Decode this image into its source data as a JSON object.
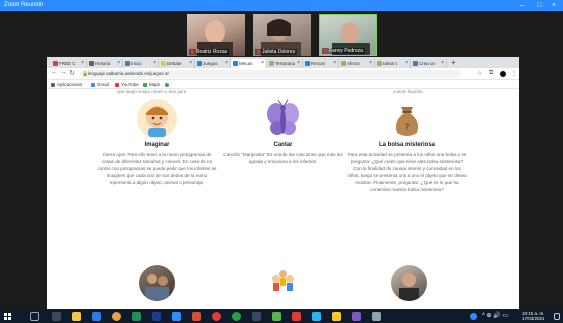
{
  "zoom": {
    "title": "Zoom Reunión",
    "window_controls": [
      "–",
      "□",
      "×"
    ],
    "participants": [
      {
        "name": "Beatriz Rozas"
      },
      {
        "name": "Julieta Dolores"
      },
      {
        "name": "Fanny Pedroza"
      }
    ]
  },
  "browser": {
    "tabs": [
      {
        "label": "FREE C",
        "color": "#e53935"
      },
      {
        "label": "Historia",
        "color": "#616161"
      },
      {
        "label": "Inicio",
        "color": "#1e88e5"
      },
      {
        "label": "Debate",
        "color": "#fbc02d"
      },
      {
        "label": "Juegos",
        "color": "#1e88e5"
      },
      {
        "label": "Mecan",
        "color": "#1e88e5"
      },
      {
        "label": "Temprana",
        "color": "#8bc34a"
      },
      {
        "label": "Recurs",
        "color": "#1e88e5"
      },
      {
        "label": "Afecto",
        "color": "#8bc34a"
      },
      {
        "label": "Ideas c",
        "color": "#8bc34a"
      },
      {
        "label": "Crea un",
        "color": "#1e88e5"
      }
    ],
    "new_tab": "+",
    "url": "lenguaje.salbarria.webnode.es/juegos-3/",
    "bookmarks": [
      {
        "label": "Aplicaciones",
        "color": "#5f6368"
      },
      {
        "label": "Gmail",
        "color": "#4285f4"
      },
      {
        "label": "YouTube",
        "color": "#e53935"
      },
      {
        "label": "Maps",
        "color": "#34a853"
      },
      {
        "label": "",
        "color": "#34a853"
      }
    ]
  },
  "page": {
    "cut_left": "que luego suspo miram y doe gure",
    "cut_right": "cuento favorito.",
    "cards": [
      {
        "title": "Imaginar",
        "text": "Cierra ojos. Para ello tener a la mano pictogramas de cosas de diferentes tamaños y colores. En caso de no contar con pictogramas se puede pedir que los infantes se imaginen que cada uno de sus dedos de la mano representa a algún objeto, animal o personaje."
      },
      {
        "title": "Cantar",
        "text": "Canción “Mariposita” Es una de las canciones que más les agrada y emociona a los infantes."
      },
      {
        "title": "La bolsa misteriosa",
        "text": "Para esta actividad se presenta a los niños una bolsa y se pregunta: ¿Qué creen que tiene esta bolsa misteriosa? Con la finalidad de causar interés y curiosidad en los niños, luego se presenta uno a uno el objeto que se desea mostrar. Finalmente, preguntar: ¿Qué es lo que ha contenido nuestra bolsa misteriosa?"
      }
    ]
  },
  "taskbar": {
    "time": "10:15 a. m.",
    "date": "17/03/2021"
  }
}
